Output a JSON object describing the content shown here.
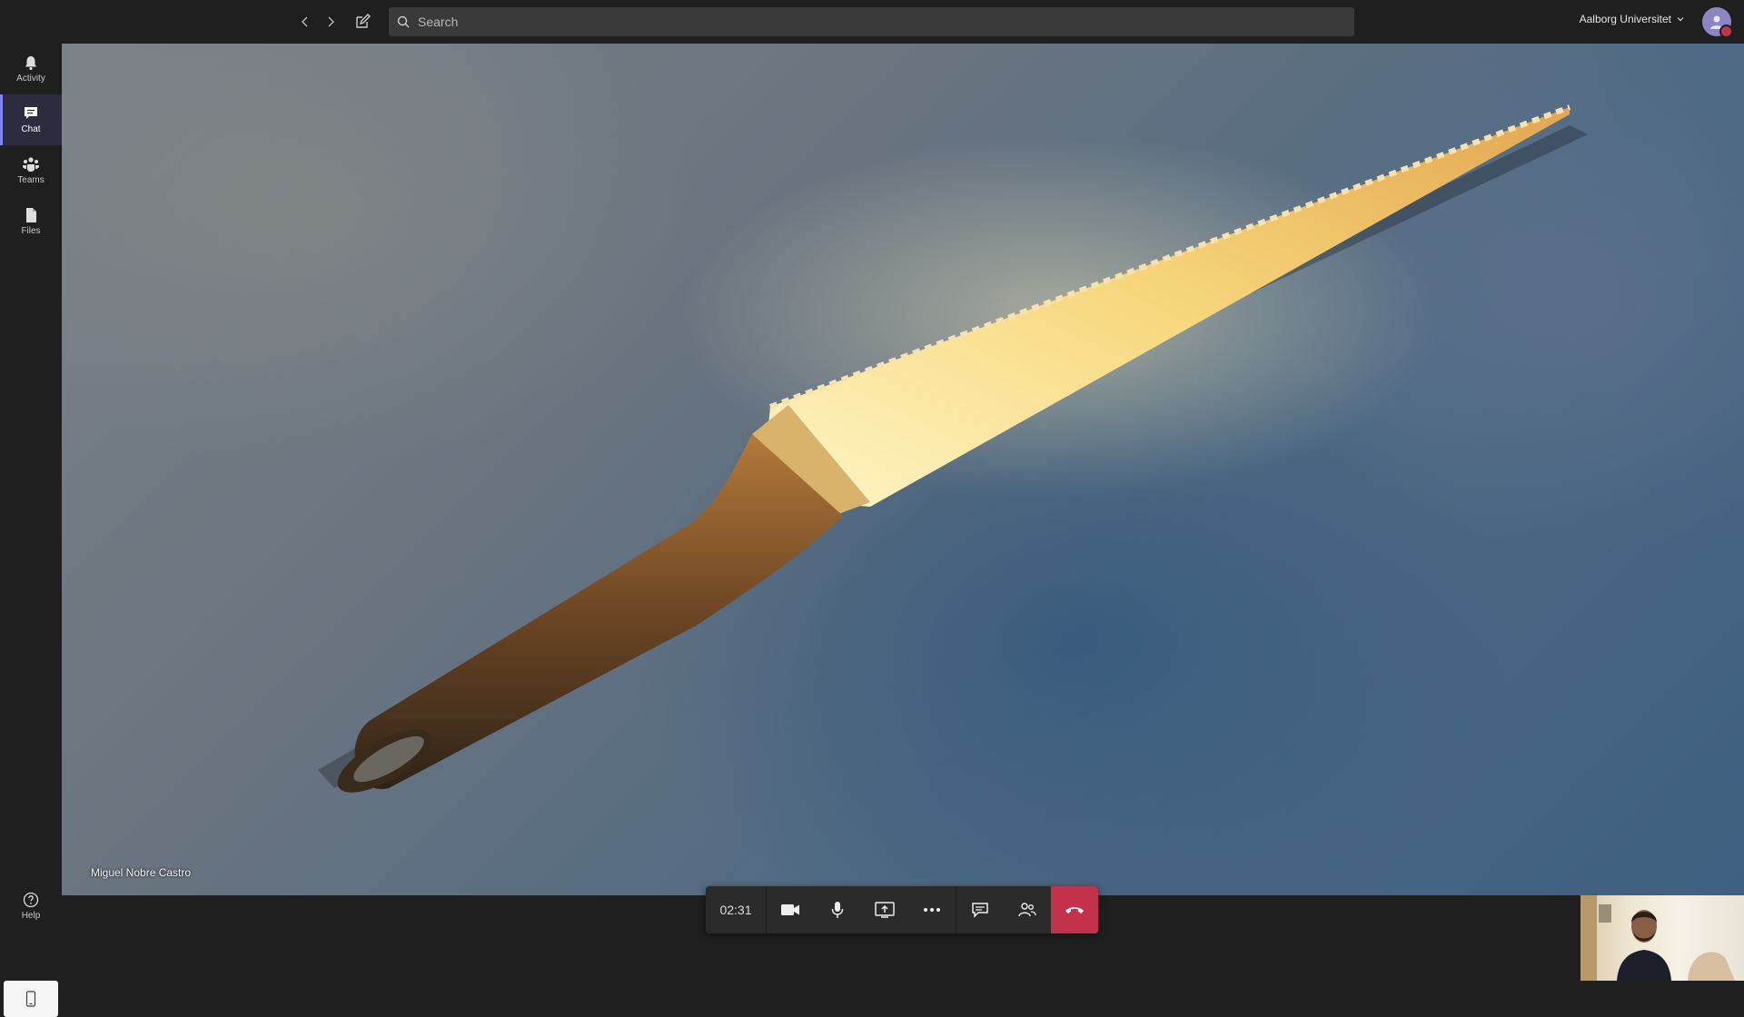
{
  "topbar": {
    "search_placeholder": "Search",
    "org_name": "Aalborg Universitet"
  },
  "rail": {
    "items": [
      {
        "label": "Activity",
        "icon": "bell-icon"
      },
      {
        "label": "Chat",
        "icon": "chat-icon",
        "active": true
      },
      {
        "label": "Teams",
        "icon": "teams-icon"
      },
      {
        "label": "Files",
        "icon": "files-icon"
      }
    ],
    "help_label": "Help"
  },
  "stage": {
    "participant_name": "Miguel Nobre Castro"
  },
  "call": {
    "timer": "02:31",
    "hangup_color": "#c4314b"
  },
  "colors": {
    "accent": "#7f85f5",
    "background": "#1f1f1f"
  }
}
